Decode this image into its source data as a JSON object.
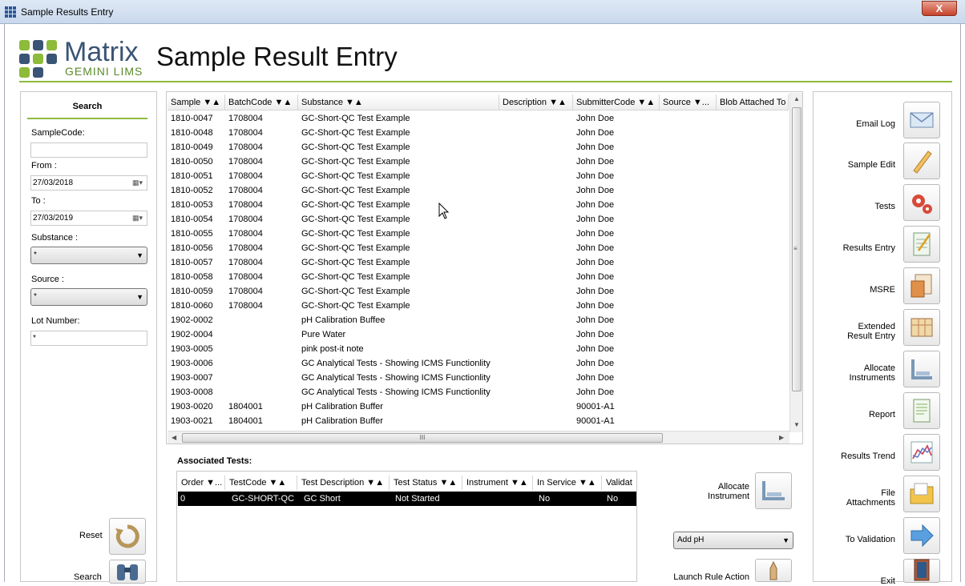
{
  "window": {
    "title": "Sample Results Entry",
    "close_label": "X"
  },
  "brand": {
    "name": "Matrix",
    "sub": "GEMINI LIMS"
  },
  "page_title": "Sample Result Entry",
  "search": {
    "heading": "Search",
    "sample_code_label": "SampleCode:",
    "sample_code_value": "",
    "from_label": "From :",
    "from_value": "27/03/2018",
    "to_label": "To :",
    "to_value": "27/03/2019",
    "substance_label": "Substance :",
    "substance_value": "*",
    "source_label": "Source :",
    "source_value": "*",
    "lot_label": "Lot Number:",
    "lot_value": "*",
    "reset_label": "Reset",
    "search_label": "Search"
  },
  "grid": {
    "columns": [
      "Sample ▼▲",
      "BatchCode ▼▲",
      "Substance ▼▲",
      "Description ▼▲",
      "SubmitterCode ▼▲",
      "Source ▼...",
      "Blob Attached To"
    ],
    "rows": [
      [
        "1810-0047",
        "1708004",
        "GC-Short-QC Test Example",
        "",
        "John Doe",
        "",
        ""
      ],
      [
        "1810-0048",
        "1708004",
        "GC-Short-QC Test Example",
        "",
        "John Doe",
        "",
        ""
      ],
      [
        "1810-0049",
        "1708004",
        "GC-Short-QC Test Example",
        "",
        "John Doe",
        "",
        ""
      ],
      [
        "1810-0050",
        "1708004",
        "GC-Short-QC Test Example",
        "",
        "John Doe",
        "",
        ""
      ],
      [
        "1810-0051",
        "1708004",
        "GC-Short-QC Test Example",
        "",
        "John Doe",
        "",
        ""
      ],
      [
        "1810-0052",
        "1708004",
        "GC-Short-QC Test Example",
        "",
        "John Doe",
        "",
        ""
      ],
      [
        "1810-0053",
        "1708004",
        "GC-Short-QC Test Example",
        "",
        "John Doe",
        "",
        ""
      ],
      [
        "1810-0054",
        "1708004",
        "GC-Short-QC Test Example",
        "",
        "John Doe",
        "",
        ""
      ],
      [
        "1810-0055",
        "1708004",
        "GC-Short-QC Test Example",
        "",
        "John Doe",
        "",
        ""
      ],
      [
        "1810-0056",
        "1708004",
        "GC-Short-QC Test Example",
        "",
        "John Doe",
        "",
        ""
      ],
      [
        "1810-0057",
        "1708004",
        "GC-Short-QC Test Example",
        "",
        "John Doe",
        "",
        ""
      ],
      [
        "1810-0058",
        "1708004",
        "GC-Short-QC Test Example",
        "",
        "John Doe",
        "",
        ""
      ],
      [
        "1810-0059",
        "1708004",
        "GC-Short-QC Test Example",
        "",
        "John Doe",
        "",
        ""
      ],
      [
        "1810-0060",
        "1708004",
        "GC-Short-QC Test Example",
        "",
        "John Doe",
        "",
        ""
      ],
      [
        "1902-0002",
        "",
        "pH Calibration Buffee",
        "",
        "John Doe",
        "",
        ""
      ],
      [
        "1902-0004",
        "",
        "Pure Water",
        "",
        "John Doe",
        "",
        ""
      ],
      [
        "1903-0005",
        "",
        "pink post-it note",
        "",
        "John Doe",
        "",
        ""
      ],
      [
        "1903-0006",
        "",
        "GC Analytical Tests - Showing ICMS Functionlity",
        "",
        "John Doe",
        "",
        ""
      ],
      [
        "1903-0007",
        "",
        "GC Analytical Tests - Showing ICMS Functionlity",
        "",
        "John Doe",
        "",
        ""
      ],
      [
        "1903-0008",
        "",
        "GC Analytical Tests - Showing ICMS Functionlity",
        "",
        "John Doe",
        "",
        ""
      ],
      [
        "1903-0020",
        "1804001",
        "pH Calibration Buffer",
        "",
        "90001-A1",
        "",
        ""
      ],
      [
        "1903-0021",
        "1804001",
        "pH Calibration Buffer",
        "",
        "90001-A1",
        "",
        ""
      ]
    ],
    "hscroll_grip": "III",
    "vscroll_grip": "≡"
  },
  "assoc": {
    "title": "Associated Tests:",
    "columns": [
      "Order ▼...",
      "TestCode ▼▲",
      "Test Description ▼▲",
      "Test Status ▼▲",
      "Instrument ▼▲",
      "In Service ▼▲",
      "Validat"
    ],
    "rows": [
      [
        "0",
        "GC-SHORT-QC",
        "GC Short",
        "Not Started",
        "",
        "No",
        "No"
      ]
    ],
    "allocate_label": "Allocate\nInstrument",
    "addph_value": "Add pH",
    "launch_label": "Launch Rule Action"
  },
  "actions": [
    {
      "label": "Email Log",
      "icon": "envelope-icon"
    },
    {
      "label": "Sample Edit",
      "icon": "pencil-icon"
    },
    {
      "label": "Tests",
      "icon": "gears-icon"
    },
    {
      "label": "Results Entry",
      "icon": "notepad-icon"
    },
    {
      "label": "MSRE",
      "icon": "documents-icon"
    },
    {
      "label": "Extended\nResult Entry",
      "icon": "table-board-icon"
    },
    {
      "label": "Allocate\nInstruments",
      "icon": "instrument-icon"
    },
    {
      "label": "Report",
      "icon": "report-icon"
    },
    {
      "label": "Results Trend",
      "icon": "trend-chart-icon"
    },
    {
      "label": "File\nAttachments",
      "icon": "folder-icon"
    },
    {
      "label": "To Validation",
      "icon": "arrow-right-icon"
    },
    {
      "label": "Exit",
      "icon": "exit-door-icon"
    }
  ],
  "colors": {
    "accent_green": "#8dbb3a",
    "brand_blue": "#3a5475",
    "selected_row": "#000000"
  }
}
